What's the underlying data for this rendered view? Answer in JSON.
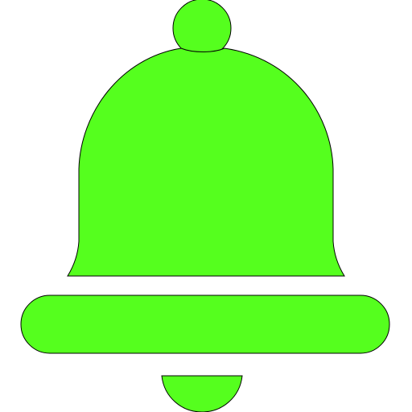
{
  "icon": {
    "name": "bell-icon",
    "fill_color": "#55ff1e",
    "stroke_color": "#000000"
  }
}
